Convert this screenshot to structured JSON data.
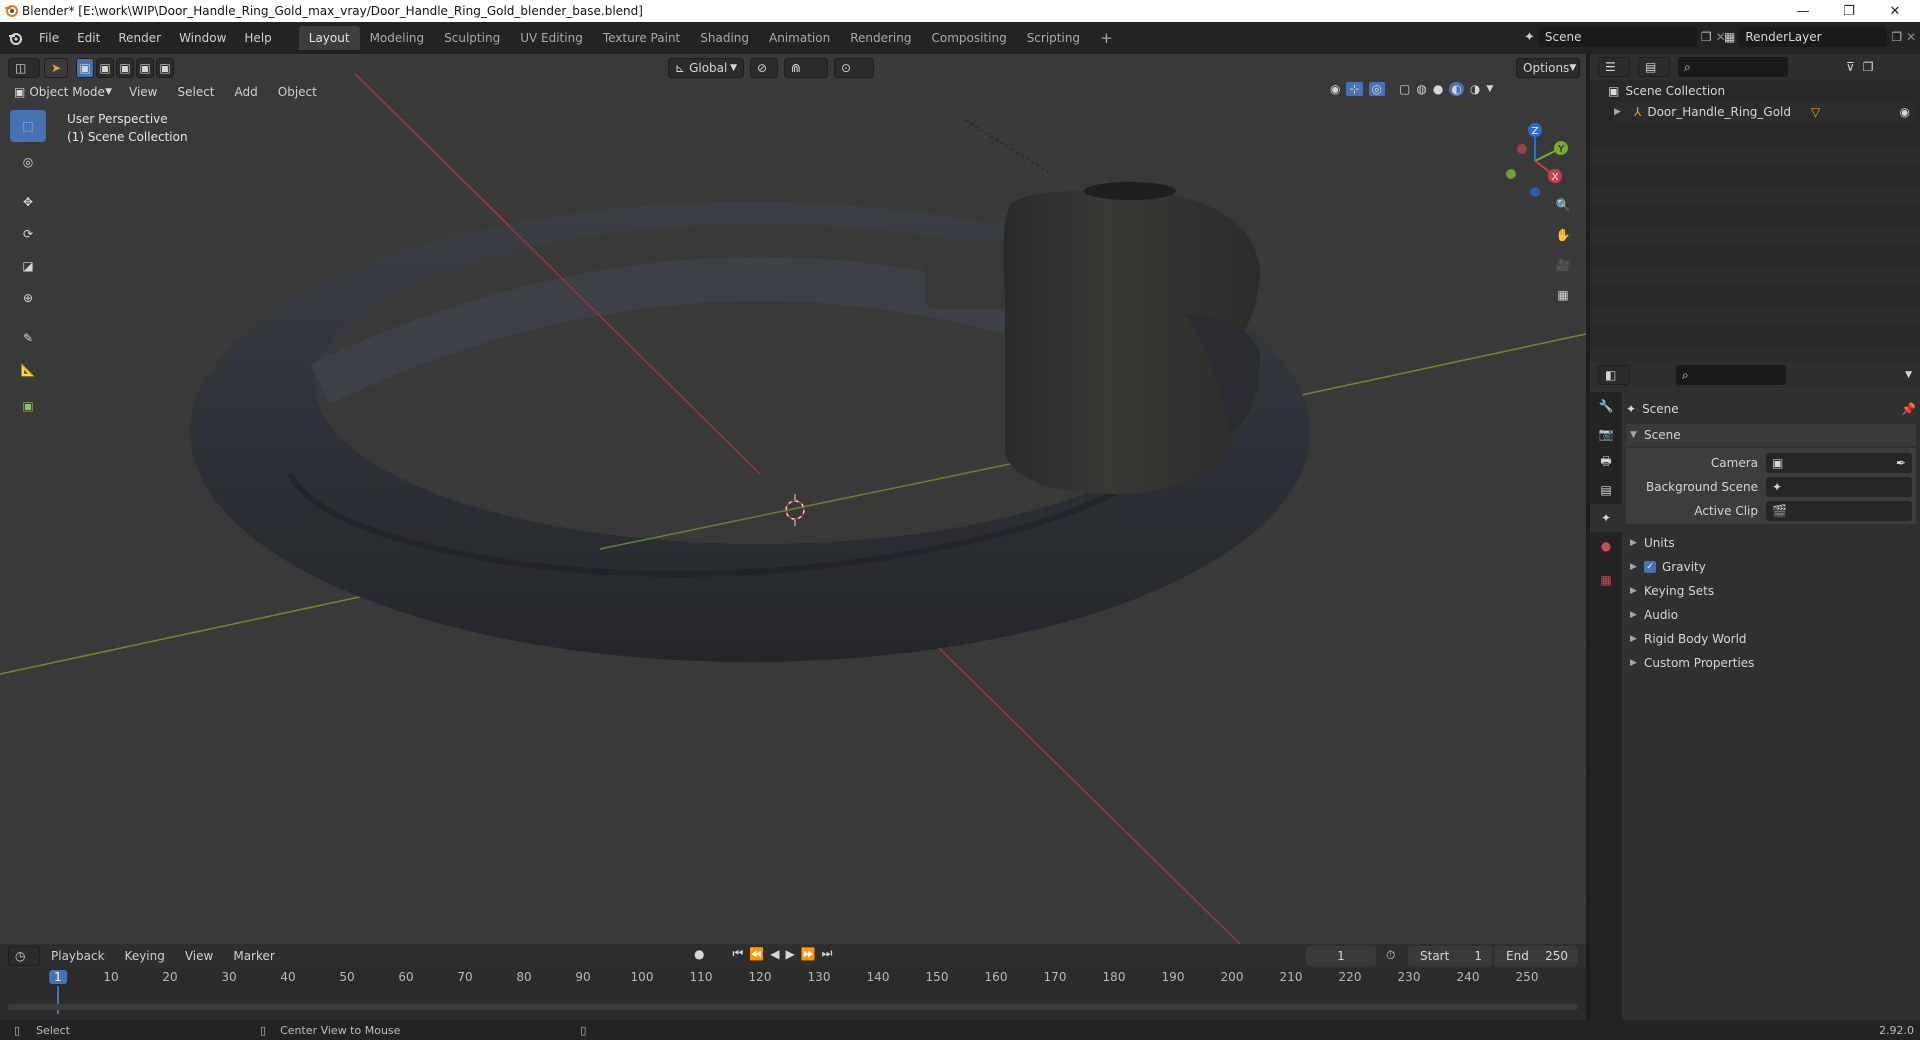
{
  "window": {
    "title": "Blender* [E:\\work\\WIP\\Door_Handle_Ring_Gold_max_vray/Door_Handle_Ring_Gold_blender_base.blend]",
    "min": "—",
    "restore": "❐",
    "close": "✕"
  },
  "menu": [
    "File",
    "Edit",
    "Render",
    "Window",
    "Help"
  ],
  "workspaces": [
    "Layout",
    "Modeling",
    "Sculpting",
    "UV Editing",
    "Texture Paint",
    "Shading",
    "Animation",
    "Rendering",
    "Compositing",
    "Scripting"
  ],
  "add_workspace": "+",
  "scene_field": "Scene",
  "renderlayer_field": "RenderLayer",
  "viewport": {
    "transform_orientation": "Global",
    "options_label": "Options",
    "mode": "Object Mode",
    "header_menus": [
      "View",
      "Select",
      "Add",
      "Object"
    ],
    "overlay_line1": "User Perspective",
    "overlay_line2": "(1) Scene Collection",
    "gizmo": {
      "x": "X",
      "y": "Y",
      "z": "Z"
    },
    "colors": {
      "background": "#393939",
      "grid": "#484848",
      "x_axis": "#9b3a3d",
      "y_axis": "#6b8c34",
      "object": "#2f3238"
    }
  },
  "outliner": {
    "root": "Scene Collection",
    "items": [
      {
        "label": "Door_Handle_Ring_Gold"
      }
    ]
  },
  "properties": {
    "context": "Scene",
    "section": "Scene",
    "fields": [
      {
        "label": "Camera"
      },
      {
        "label": "Background Scene"
      },
      {
        "label": "Active Clip"
      }
    ],
    "panels": [
      "Units",
      "Gravity",
      "Keying Sets",
      "Audio",
      "Rigid Body World",
      "Custom Properties"
    ],
    "gravity_checked": true
  },
  "timeline": {
    "menus": [
      "Playback",
      "Keying",
      "View",
      "Marker"
    ],
    "current_frame": "1",
    "start_label": "Start",
    "start": "1",
    "end_label": "End",
    "end": "250",
    "ticks": [
      "1",
      "10",
      "20",
      "30",
      "40",
      "50",
      "60",
      "70",
      "80",
      "90",
      "100",
      "110",
      "120",
      "130",
      "140",
      "150",
      "160",
      "170",
      "180",
      "190",
      "200",
      "210",
      "220",
      "230",
      "240",
      "250"
    ]
  },
  "status": {
    "left": "Select",
    "middle": "Center View to Mouse",
    "version": "2.92.0"
  },
  "accent_color": "#4772b3"
}
